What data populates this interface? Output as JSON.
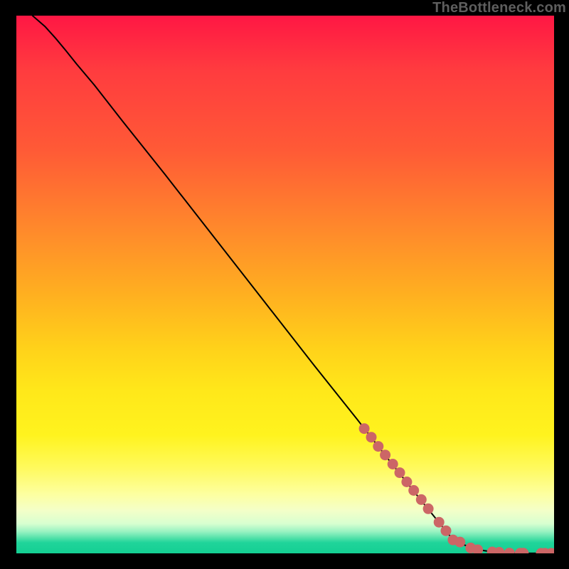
{
  "watermark": "TheBottleneck.com",
  "chart_data": {
    "type": "line",
    "title": "",
    "xlabel": "",
    "ylabel": "",
    "xlim": [
      0,
      100
    ],
    "ylim": [
      0,
      100
    ],
    "grid": false,
    "legend": false,
    "series": [
      {
        "name": "curve",
        "type": "line",
        "color": "#000000",
        "x": [
          3.0,
          5.3,
          7.3,
          9.2,
          11.2,
          14.5,
          19.8,
          27.7,
          37.0,
          46.2,
          55.5,
          63.4,
          68.7,
          75.3,
          80.6,
          83.2,
          85.8,
          89.1,
          91.7,
          92.6,
          93.7,
          94.3,
          95.0,
          95.6,
          96.3,
          97.0,
          97.6,
          98.3,
          99.0,
          99.5
        ],
        "y": [
          100.0,
          98.0,
          95.8,
          93.5,
          91.0,
          87.1,
          80.3,
          70.4,
          58.5,
          46.7,
          34.8,
          24.9,
          18.1,
          9.8,
          3.3,
          1.6,
          0.7,
          0.19,
          0.05,
          0.037,
          0.027,
          0.023,
          0.019,
          0.017,
          0.015,
          0.013,
          0.012,
          0.011,
          0.01,
          0.01
        ]
      },
      {
        "name": "dots",
        "type": "scatter",
        "color": "#cc6666",
        "x": [
          64.7,
          66.0,
          67.3,
          68.6,
          70.0,
          71.3,
          72.6,
          73.9,
          75.3,
          76.6,
          78.6,
          79.9,
          81.2,
          82.5,
          84.5,
          85.8,
          88.5,
          89.8,
          91.7,
          93.7,
          94.3,
          97.6,
          98.3,
          99.5
        ],
        "y": [
          23.2,
          21.6,
          19.9,
          18.3,
          16.6,
          15.0,
          13.3,
          11.7,
          10.0,
          8.3,
          5.8,
          4.2,
          2.5,
          2.1,
          1.0,
          0.66,
          0.26,
          0.2,
          0.05,
          0.027,
          0.023,
          0.012,
          0.011,
          0.01
        ]
      }
    ]
  }
}
